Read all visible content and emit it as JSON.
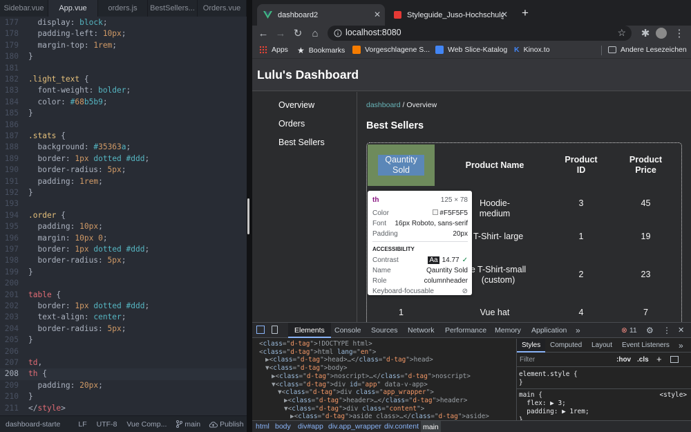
{
  "editor": {
    "tabs": [
      {
        "label": "Sidebar.vue",
        "active": false
      },
      {
        "label": "App.vue",
        "active": true
      },
      {
        "label": "orders.js",
        "active": false
      },
      {
        "label": "BestSellers...",
        "active": false
      },
      {
        "label": "Orders.vue",
        "active": false
      }
    ],
    "current_line": "208",
    "lines": [
      {
        "n": "177",
        "t": "  display: block;"
      },
      {
        "n": "178",
        "t": "  padding-left: 10px;"
      },
      {
        "n": "179",
        "t": "  margin-top: 1rem;"
      },
      {
        "n": "180",
        "t": "}"
      },
      {
        "n": "181",
        "t": ""
      },
      {
        "n": "182",
        "t": ".light_text {"
      },
      {
        "n": "183",
        "t": "  font-weight: bolder;"
      },
      {
        "n": "184",
        "t": "  color: #68b5b9;"
      },
      {
        "n": "185",
        "t": "}"
      },
      {
        "n": "186",
        "t": ""
      },
      {
        "n": "187",
        "t": ".stats {"
      },
      {
        "n": "188",
        "t": "  background: #35363a;"
      },
      {
        "n": "189",
        "t": "  border: 1px dotted #ddd;"
      },
      {
        "n": "190",
        "t": "  border-radius: 5px;"
      },
      {
        "n": "191",
        "t": "  padding: 1rem;"
      },
      {
        "n": "192",
        "t": "}"
      },
      {
        "n": "193",
        "t": ""
      },
      {
        "n": "194",
        "t": ".order {"
      },
      {
        "n": "195",
        "t": "  padding: 10px;"
      },
      {
        "n": "196",
        "t": "  margin: 10px 0;"
      },
      {
        "n": "197",
        "t": "  border: 1px dotted #ddd;"
      },
      {
        "n": "198",
        "t": "  border-radius: 5px;"
      },
      {
        "n": "199",
        "t": "}"
      },
      {
        "n": "200",
        "t": ""
      },
      {
        "n": "201",
        "t": "table {"
      },
      {
        "n": "202",
        "t": "  border: 1px dotted #ddd;"
      },
      {
        "n": "203",
        "t": "  text-align: center;"
      },
      {
        "n": "204",
        "t": "  border-radius: 5px;"
      },
      {
        "n": "205",
        "t": "}"
      },
      {
        "n": "206",
        "t": ""
      },
      {
        "n": "207",
        "t": "td,"
      },
      {
        "n": "208",
        "t": "th {"
      },
      {
        "n": "209",
        "t": "  padding: 20px;"
      },
      {
        "n": "210",
        "t": "}"
      },
      {
        "n": "211",
        "t": "</style>"
      }
    ],
    "status": {
      "project": "dashboard-starte",
      "line_ending": "LF",
      "encoding": "UTF-8",
      "grammar": "Vue Comp...",
      "branch": "main",
      "publish": "Publish"
    }
  },
  "browser": {
    "tabs": [
      {
        "title": "dashboard2",
        "active": true
      },
      {
        "title": "Styleguide_Juso-Hochschulgr...",
        "active": false
      }
    ],
    "new_tab": "+",
    "url": "localhost:8080",
    "bookmarks": [
      {
        "label": "Apps",
        "icon": "apps-grid-icon",
        "color": "#ea4335"
      },
      {
        "label": "Bookmarks",
        "icon": "star-icon",
        "color": "#e8eaed"
      },
      {
        "label": "Vorgeschlagene S...",
        "icon": "bookmark-icon",
        "color": "#f57c00"
      },
      {
        "label": "Web Slice-Katalog",
        "icon": "web-slice-icon",
        "color": "#4285f4"
      },
      {
        "label": "Kinox.to",
        "icon": "kinox-icon",
        "color": "#1565c0"
      },
      {
        "label": "Andere Lesezeichen",
        "icon": "folder-icon",
        "color": "#bdc1c6"
      }
    ],
    "bookmark_k": "K"
  },
  "page": {
    "title": "Lulu's Dashboard",
    "nav": [
      "Overview",
      "Orders",
      "Best Sellers"
    ],
    "breadcrumb": {
      "link": "dashboard",
      "sep": " / ",
      "current": "Overview"
    },
    "section_title": "Best Sellers",
    "table": {
      "headers": [
        [
          "Qauntity",
          "Sold"
        ],
        [
          "Product Name"
        ],
        [
          "Product",
          "ID"
        ],
        [
          "Product",
          "Price"
        ]
      ],
      "rows": [
        {
          "name": [
            "Hoodie- medium"
          ],
          "id": "3",
          "price": "45"
        },
        {
          "name": [
            "e T-Shirt- large"
          ],
          "id": "1",
          "price": "19"
        },
        {
          "name": [
            "e T-Shirt-small",
            "(custom)"
          ],
          "id": "2",
          "price": "23"
        },
        {
          "qty": "1",
          "name": [
            "Vue hat"
          ],
          "id": "4",
          "price": "7"
        }
      ]
    },
    "tooltip": {
      "tag": "th",
      "size": "125 × 78",
      "color_label": "Color",
      "color_value": "#F5F5F5",
      "font_label": "Font",
      "font_value": "16px Roboto, sans-serif",
      "padding_label": "Padding",
      "padding_value": "20px",
      "a11y_title": "ACCESSIBILITY",
      "contrast_label": "Contrast",
      "contrast_badge": "Aa",
      "contrast_value": "14.77",
      "name_label": "Name",
      "name_value": "Qauntity Sold",
      "role_label": "Role",
      "role_value": "columnheader",
      "kb_label": "Keyboard-focusable"
    }
  },
  "devtools": {
    "tabs": [
      "Elements",
      "Console",
      "Sources",
      "Network",
      "Performance",
      "Memory",
      "Application"
    ],
    "more": "»",
    "error_count": "11",
    "dom": [
      {
        "indent": 0,
        "text": "<!DOCTYPE html>"
      },
      {
        "indent": 0,
        "text": "<html lang=\"en\">"
      },
      {
        "indent": 1,
        "text": "▶<head>…</head>"
      },
      {
        "indent": 1,
        "text": "▼<body>"
      },
      {
        "indent": 2,
        "text": "▶<noscript>…</noscript>"
      },
      {
        "indent": 2,
        "text": "▼<div id=\"app\" data-v-app>"
      },
      {
        "indent": 3,
        "text": "▼<div class=\"app_wrapper\">"
      },
      {
        "indent": 4,
        "text": "▶<header>…</header>"
      },
      {
        "indent": 4,
        "text": "▼<div class=\"content\">"
      },
      {
        "indent": 5,
        "text": "▶<aside class>…</aside>"
      }
    ],
    "style_tabs": [
      "Styles",
      "Computed",
      "Layout",
      "Event Listeners"
    ],
    "filter_placeholder": "Filter",
    "hov": ":hov",
    "cls": ".cls",
    "element_style": "element.style {\n}",
    "main_rule": "main {\n  flex: ▶ 3;\n  padding: ▶ 1rem;\n}",
    "main_source": "<style>",
    "crumbs": [
      "html",
      "body",
      "div#app",
      "div.app_wrapper",
      "div.content",
      "main"
    ]
  }
}
